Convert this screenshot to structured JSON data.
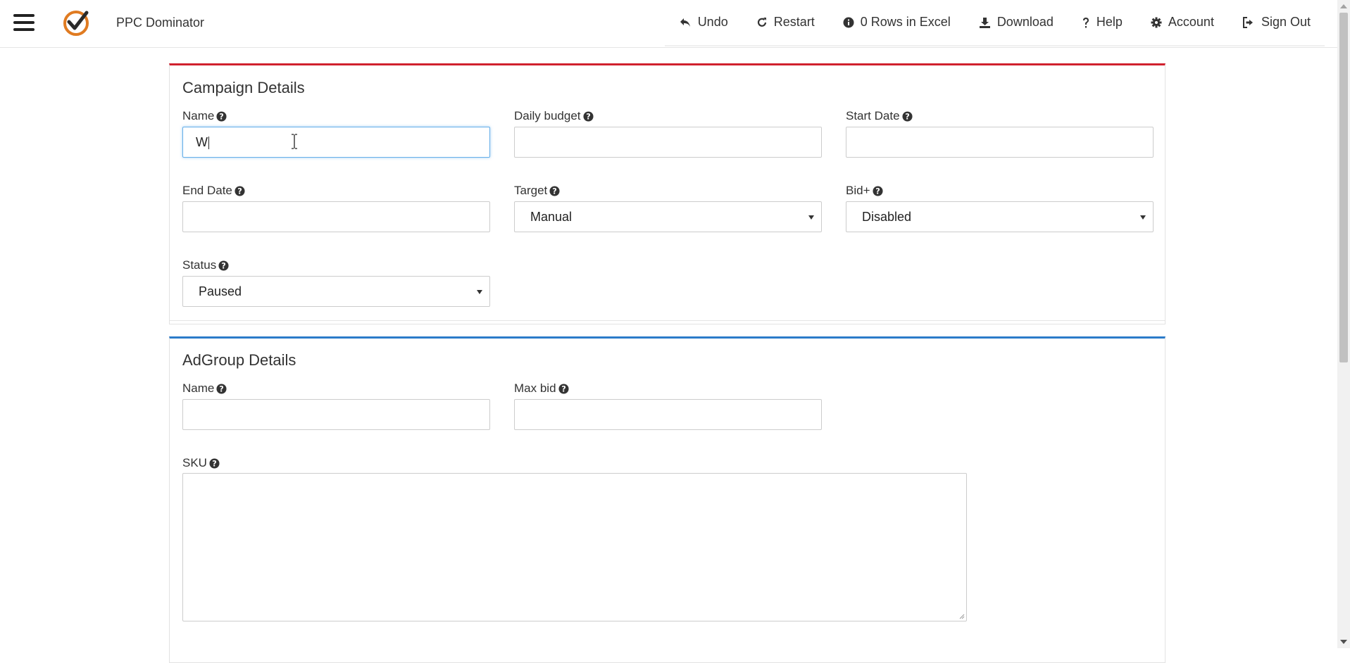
{
  "app": {
    "title": "PPC Dominator"
  },
  "nav": {
    "items": [
      {
        "label": "Undo",
        "icon": "undo-icon"
      },
      {
        "label": "Restart",
        "icon": "restart-icon"
      },
      {
        "label": "0 Rows in Excel",
        "icon": "info-icon"
      },
      {
        "label": "Download",
        "icon": "download-icon"
      },
      {
        "label": "Help",
        "icon": "question-icon"
      },
      {
        "label": "Account",
        "icon": "gear-icon"
      },
      {
        "label": "Sign Out",
        "icon": "sign-out-icon"
      }
    ]
  },
  "campaign": {
    "title": "Campaign Details",
    "accent": "#d0212e",
    "fields": {
      "name": {
        "label": "Name",
        "value": "W"
      },
      "daily_budget": {
        "label": "Daily budget",
        "value": ""
      },
      "start_date": {
        "label": "Start Date",
        "value": ""
      },
      "end_date": {
        "label": "End Date",
        "value": ""
      },
      "target": {
        "label": "Target",
        "value": "Manual"
      },
      "bid_plus": {
        "label": "Bid+",
        "value": "Disabled"
      },
      "status": {
        "label": "Status",
        "value": "Paused"
      }
    }
  },
  "adgroup": {
    "title": "AdGroup Details",
    "accent": "#2b7bc9",
    "fields": {
      "name": {
        "label": "Name",
        "value": ""
      },
      "max_bid": {
        "label": "Max bid",
        "value": ""
      },
      "sku": {
        "label": "SKU",
        "value": ""
      }
    }
  }
}
